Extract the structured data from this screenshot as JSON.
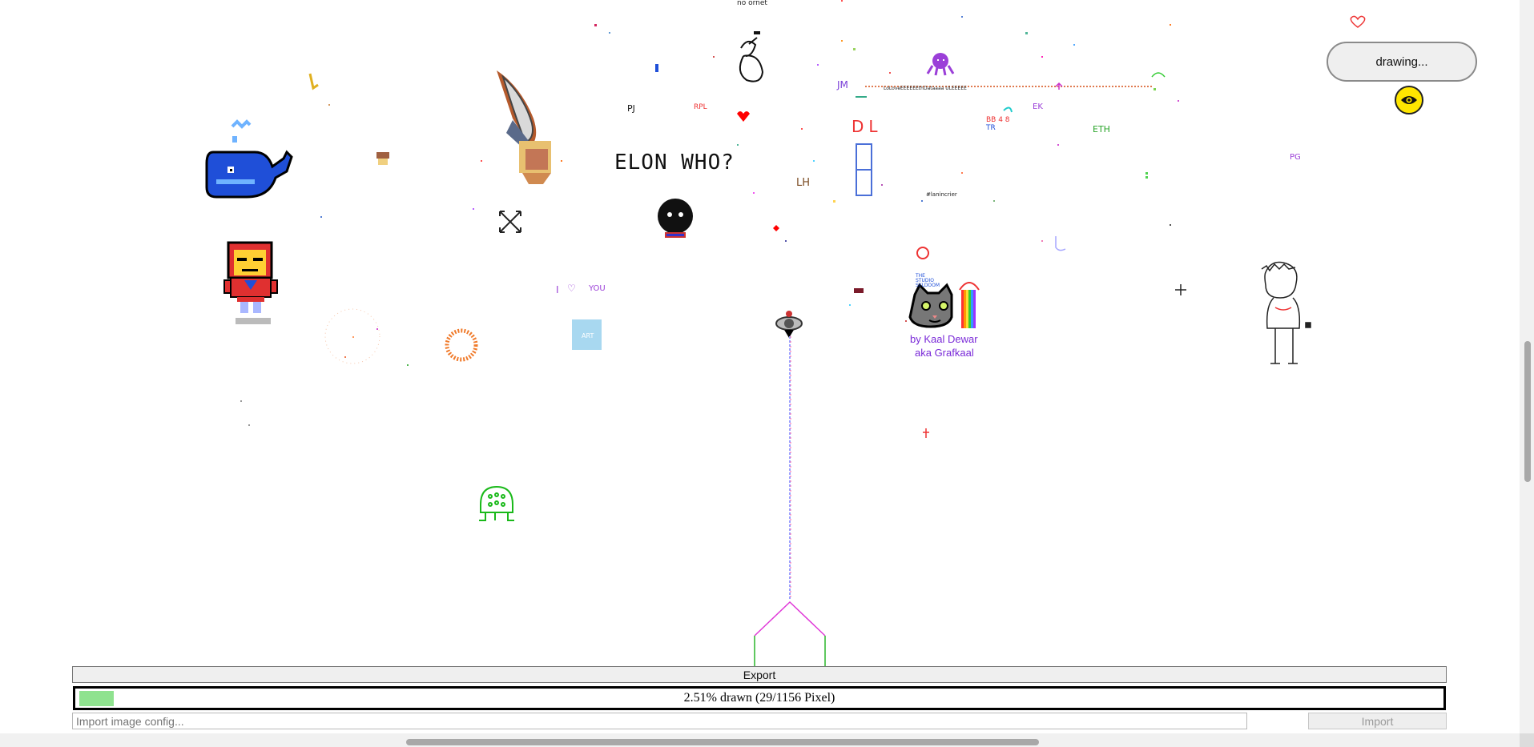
{
  "status": {
    "label": "drawing...",
    "eye_icon": "eye-icon"
  },
  "canvas": {
    "texts": {
      "elon": "ELON WHO?",
      "pj": "PJ",
      "rpl": "RPL",
      "jm": "JM",
      "dl": "DL",
      "lh": "LH",
      "eth": "ETH",
      "pg": "PG",
      "ek": "EK",
      "i_love_you_i": "I",
      "i_love_you_you": "YOU",
      "studio_line1": "THE",
      "studio_line2": "STUDIO",
      "studio_line3": "SYLDOOM",
      "kaal_line1": "by Kaal Dewar",
      "kaal_line2": "aka Grafkaal",
      "art": "ART",
      "top_fragment": "no ornet",
      "hashtag": "#lanincrier",
      "love_line": "LoLoveEEEEEEthDataaaa ULEEEEE",
      "tr_label": "TR",
      "num_label": "BB 4 8"
    }
  },
  "toolbar": {
    "export_label": "Export",
    "progress_text": "2.51% drawn (29/1156 Pixel)",
    "progress_fraction": 0.0251,
    "import_placeholder": "Import image config...",
    "import_label": "Import"
  },
  "colors": {
    "progress_fill": "#8fe28f",
    "eye_button": "#ffe600",
    "whale": "#1f4fd8",
    "ironman_red": "#e03030",
    "ironman_gold": "#ffcf33"
  }
}
